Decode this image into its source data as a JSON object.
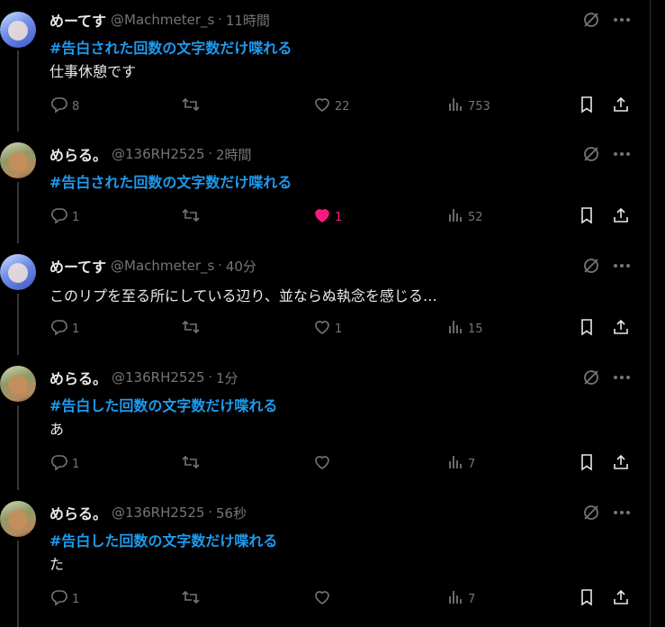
{
  "tweets": [
    {
      "author_name": "めーてす",
      "handle": "@Machmeter_s",
      "separator": "·",
      "time": "11時間",
      "hashtag": "#告白された回数の文字数だけ喋れる",
      "text": "仕事休憩です",
      "replies": "8",
      "retweets": "",
      "likes": "22",
      "liked": false,
      "views": "753",
      "avatar": "avatar-blue-hair"
    },
    {
      "author_name": "めらる。",
      "handle": "@136RH2525",
      "separator": "·",
      "time": "2時間",
      "hashtag": "#告白された回数の文字数だけ喋れる",
      "text": "",
      "replies": "1",
      "retweets": "",
      "likes": "1",
      "liked": true,
      "views": "52",
      "avatar": "avatar-green-hat"
    },
    {
      "author_name": "めーてす",
      "handle": "@Machmeter_s",
      "separator": "·",
      "time": "40分",
      "hashtag": "",
      "text": "このリプを至る所にしている辺り、並ならぬ執念を感じる…",
      "replies": "1",
      "retweets": "",
      "likes": "1",
      "liked": false,
      "views": "15",
      "avatar": "avatar-blue-hair"
    },
    {
      "author_name": "めらる。",
      "handle": "@136RH2525",
      "separator": "·",
      "time": "1分",
      "hashtag": "#告白した回数の文字数だけ喋れる",
      "text": "あ",
      "replies": "1",
      "retweets": "",
      "likes": "",
      "liked": false,
      "views": "7",
      "avatar": "avatar-green-hat"
    },
    {
      "author_name": "めらる。",
      "handle": "@136RH2525",
      "separator": "·",
      "time": "56秒",
      "hashtag": "#告白した回数の文字数だけ喋れる",
      "text": "た",
      "replies": "1",
      "retweets": "",
      "likes": "",
      "liked": false,
      "views": "7",
      "avatar": "avatar-green-hat"
    }
  ],
  "colors": {
    "background": "#000000",
    "text": "#e7e9ea",
    "muted": "#71767b",
    "hashtag": "#1d9bf0",
    "like_active": "#f91880",
    "thread_line": "#333639"
  },
  "icons": [
    "grok-icon",
    "more-icon",
    "reply-icon",
    "retweet-icon",
    "like-icon",
    "views-icon",
    "bookmark-icon",
    "share-icon"
  ]
}
